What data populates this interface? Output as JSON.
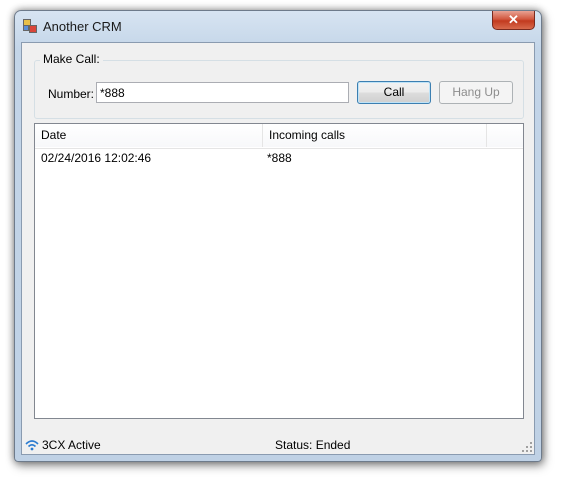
{
  "window": {
    "title": "Another CRM",
    "close_glyph": "✕"
  },
  "make_call": {
    "group_label": "Make Call:",
    "number_label": "Number:",
    "number_value": "*888",
    "call_button": "Call",
    "hangup_button": "Hang Up"
  },
  "calls_list": {
    "columns": [
      "Date",
      "Incoming calls"
    ],
    "rows": [
      {
        "date": "02/24/2016 12:02:46",
        "number": "*888"
      }
    ]
  },
  "statusbar": {
    "connection_icon": "wifi-icon",
    "connection_text": "3CX Active",
    "status_text": "Status: Ended"
  }
}
